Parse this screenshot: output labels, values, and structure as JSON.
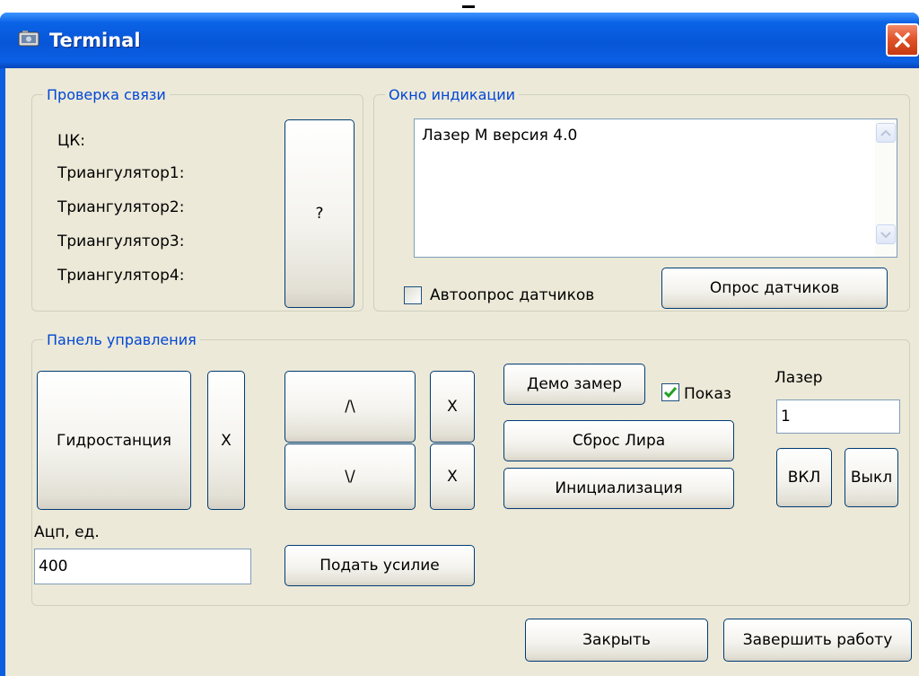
{
  "window": {
    "title": "Terminal"
  },
  "check_group": {
    "legend": "Проверка связи",
    "labels": [
      "ЦК:",
      "Триангулятор1:",
      "Триангулятор2:",
      "Триангулятор3:",
      "Триангулятор4:"
    ],
    "check_button": "?"
  },
  "indication": {
    "legend": "Окно индикации",
    "text": "Лазер М версия 4.0",
    "auto_poll_label": "Автоопрос датчиков",
    "auto_poll_checked": false,
    "poll_button": "Опрос датчиков"
  },
  "control": {
    "legend": "Панель управления",
    "hydro_button": "Гидростанция",
    "hydro_x": "X",
    "up_button": "/\\",
    "up_x": "X",
    "down_button": "\\/",
    "down_x": "X",
    "demo_button": "Демо замер",
    "show_label": "Показ",
    "show_checked": true,
    "reset_button": "Сброс Лира",
    "init_button": "Инициализация",
    "laser_label": "Лазер",
    "laser_value": "1",
    "on_button": "ВКЛ",
    "off_button": "Выкл",
    "adc_label": "Ацп, ед.",
    "adc_value": "400",
    "force_button": "Подать усилие"
  },
  "footer": {
    "close_button": "Закрыть",
    "finish_button": "Завершить работу"
  },
  "icons": [
    "window-app-icon",
    "close-icon",
    "scroll-up-icon",
    "scroll-down-icon",
    "checkmark-icon"
  ],
  "colors": {
    "titlebar": "#0a5fe4",
    "client": "#ece9d8",
    "legend": "#0046d5",
    "close": "#e2542b",
    "check": "#21a121"
  }
}
